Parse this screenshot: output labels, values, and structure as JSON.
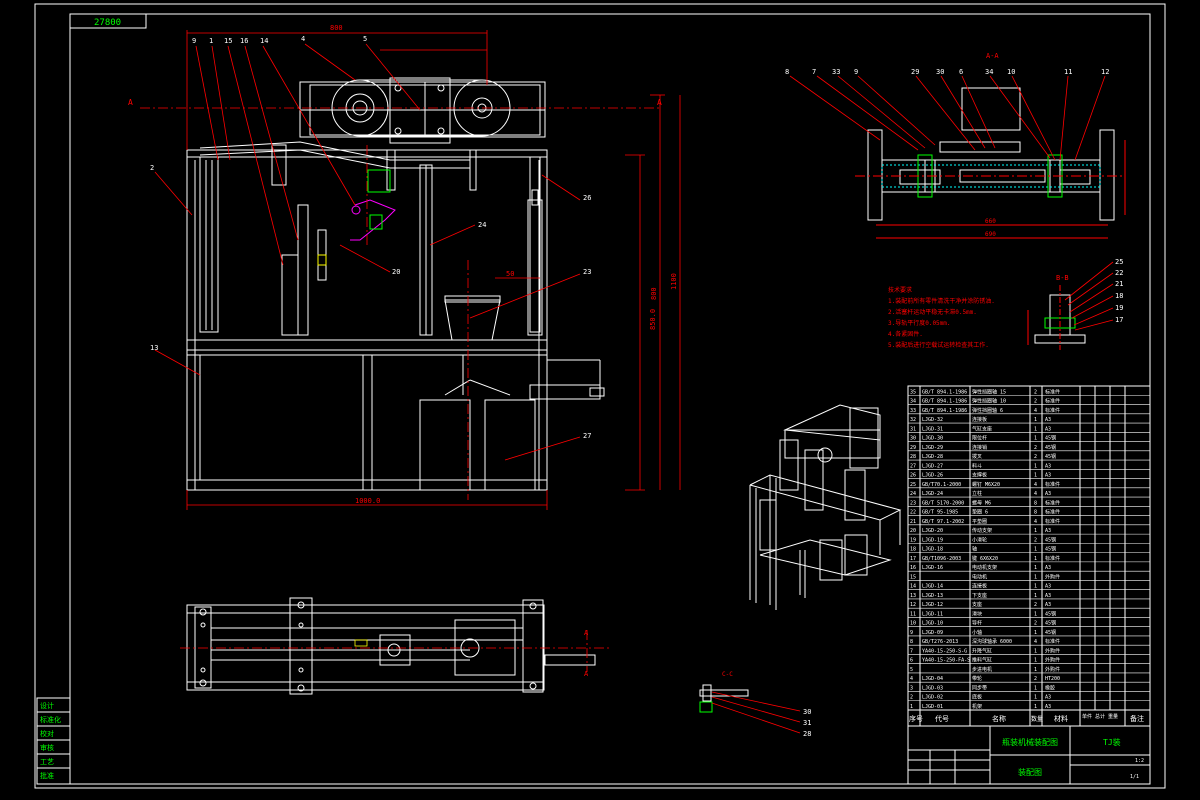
{
  "title_block": {
    "drawing_no": "27800",
    "machine_name": "瓶装机械装配图",
    "drawing_title": "装配图",
    "scale_label": "1:2",
    "code_label": "TJ装",
    "sheet": "1/1"
  },
  "bom_header": {
    "seq": "序号",
    "code": "代号",
    "name": "名称",
    "qty": "数量",
    "material": "材料",
    "weight": "单件 总计 重量",
    "note": "备注"
  },
  "bom_rows": [
    {
      "no": "35",
      "code": "GB/T 894.1-1986",
      "name": "弹性挡圈轴 15",
      "qty": "2",
      "note": "标准件"
    },
    {
      "no": "34",
      "code": "GB/T 894.1-1986",
      "name": "弹性挡圈轴 10",
      "qty": "2",
      "note": "标准件"
    },
    {
      "no": "33",
      "code": "GB/T 894.1-1986",
      "name": "弹性挡圈轴 6",
      "qty": "4",
      "note": "标准件"
    },
    {
      "no": "32",
      "code": "LJGD-32",
      "name": "连接板",
      "qty": "1",
      "note": "A3"
    },
    {
      "no": "31",
      "code": "LJGD-31",
      "name": "气缸支座",
      "qty": "1",
      "note": "A3"
    },
    {
      "no": "30",
      "code": "LJGD-30",
      "name": "限位杆",
      "qty": "1",
      "note": "45钢"
    },
    {
      "no": "29",
      "code": "LJGD-29",
      "name": "连接销",
      "qty": "2",
      "note": "45钢"
    },
    {
      "no": "28",
      "code": "LJGD-28",
      "name": "拨叉",
      "qty": "2",
      "note": "45钢"
    },
    {
      "no": "27",
      "code": "LJGD-27",
      "name": "料斗",
      "qty": "1",
      "note": "A3"
    },
    {
      "no": "26",
      "code": "LJGD-26",
      "name": "支撑板",
      "qty": "1",
      "note": "A3"
    },
    {
      "no": "25",
      "code": "GB/T70.1-2000",
      "name": "螺钉 M6X20",
      "qty": "4",
      "note": "标准件"
    },
    {
      "no": "24",
      "code": "LJGD-24",
      "name": "立柱",
      "qty": "4",
      "note": "A3"
    },
    {
      "no": "23",
      "code": "GB/T 5170-2000",
      "name": "螺母 M6",
      "qty": "8",
      "note": "标准件"
    },
    {
      "no": "22",
      "code": "GB/T 95-1985",
      "name": "垫圈 6",
      "qty": "8",
      "note": "标准件"
    },
    {
      "no": "21",
      "code": "GB/T 97.1-2002",
      "name": "平垫圈",
      "qty": "4",
      "note": "标准件"
    },
    {
      "no": "20",
      "code": "LJGD-20",
      "name": "传动支架",
      "qty": "1",
      "note": "A3"
    },
    {
      "no": "19",
      "code": "LJGD-19",
      "name": "小滑轮",
      "qty": "2",
      "note": "45钢"
    },
    {
      "no": "18",
      "code": "LJGD-18",
      "name": "轴",
      "qty": "1",
      "note": "45钢"
    },
    {
      "no": "17",
      "code": "GB/T1096-2003",
      "name": "键 6X6X20",
      "qty": "1",
      "note": "标准件"
    },
    {
      "no": "16",
      "code": "LJGD-16",
      "name": "电动机支架",
      "qty": "1",
      "note": "A3"
    },
    {
      "no": "15",
      "code": "",
      "name": "电动机",
      "qty": "1",
      "note": "外购件"
    },
    {
      "no": "14",
      "code": "LJGD-14",
      "name": "连接板",
      "qty": "1",
      "note": "A3"
    },
    {
      "no": "13",
      "code": "LJGD-13",
      "name": "下支座",
      "qty": "1",
      "note": "A3"
    },
    {
      "no": "12",
      "code": "LJGD-12",
      "name": "支座",
      "qty": "2",
      "note": "A3"
    },
    {
      "no": "11",
      "code": "LJGD-11",
      "name": "滑块",
      "qty": "1",
      "note": "45钢"
    },
    {
      "no": "10",
      "code": "LJGD-10",
      "name": "导杆",
      "qty": "2",
      "note": "45钢"
    },
    {
      "no": "9",
      "code": "LJGD-09",
      "name": "小轴",
      "qty": "1",
      "note": "45钢"
    },
    {
      "no": "8",
      "code": "GB/T276-2013",
      "name": "深沟球轴承 6000",
      "qty": "4",
      "note": "标准件"
    },
    {
      "no": "7",
      "code": "YA40-15-250-S-G",
      "name": "升降气缸",
      "qty": "1",
      "note": "外购件"
    },
    {
      "no": "6",
      "code": "YA40-15-250-FA-S",
      "name": "推料气缸",
      "qty": "1",
      "note": "外购件"
    },
    {
      "no": "5",
      "code": "",
      "name": "步进电机",
      "qty": "1",
      "note": "外购件"
    },
    {
      "no": "4",
      "code": "LJGD-04",
      "name": "带轮",
      "qty": "2",
      "note": "HT200"
    },
    {
      "no": "3",
      "code": "LJGD-03",
      "name": "同步带",
      "qty": "1",
      "note": "橡胶"
    },
    {
      "no": "2",
      "code": "LJGD-02",
      "name": "底板",
      "qty": "1",
      "note": "A3"
    },
    {
      "no": "1",
      "code": "LJGD-01",
      "name": "机架",
      "qty": "1",
      "note": "A3"
    }
  ],
  "tech_req": {
    "heading": "技术要求",
    "items": [
      "1.装配前所有零件清洗干净并涂防锈油.",
      "2.活塞杆运动平稳无卡滞0.5mm.",
      "3.导轨平行度0.05mm.",
      "4.各紧固件.",
      "5.装配后进行空载试运转检查其工作."
    ]
  },
  "view_labels": {
    "section_aa": "A-A",
    "section_bb": "B-B",
    "detail_cc": "C-C",
    "arrow_a": "A"
  },
  "dimensions": {
    "top_width": "800",
    "base_width": "1000.0",
    "height_left": "850.0",
    "height_total": "1100",
    "height_mid": "800",
    "hopper_w": "50",
    "side_width": "660",
    "side_total": "690"
  },
  "part_numbers_main": [
    "9",
    "1",
    "15",
    "16",
    "14",
    "4",
    "5",
    "2",
    "13",
    "26",
    "24",
    "20",
    "23",
    "27"
  ],
  "part_numbers_side": [
    "8",
    "7",
    "33",
    "9",
    "29",
    "30",
    "6",
    "34",
    "10",
    "11",
    "12"
  ],
  "part_numbers_bb": [
    "25",
    "22",
    "21",
    "18",
    "19",
    "17"
  ],
  "part_numbers_cc": [
    "30",
    "31",
    "28"
  ],
  "left_strip": [
    "设计",
    "标准化",
    "校对",
    "审核",
    "工艺",
    "批准"
  ],
  "colors": {
    "line": "#ffffff",
    "leader": "#ff0000",
    "dim": "#ff0000",
    "green": "#00ff00",
    "magenta": "#ff00ff",
    "yellow": "#ffff00",
    "center": "#ff0000"
  }
}
